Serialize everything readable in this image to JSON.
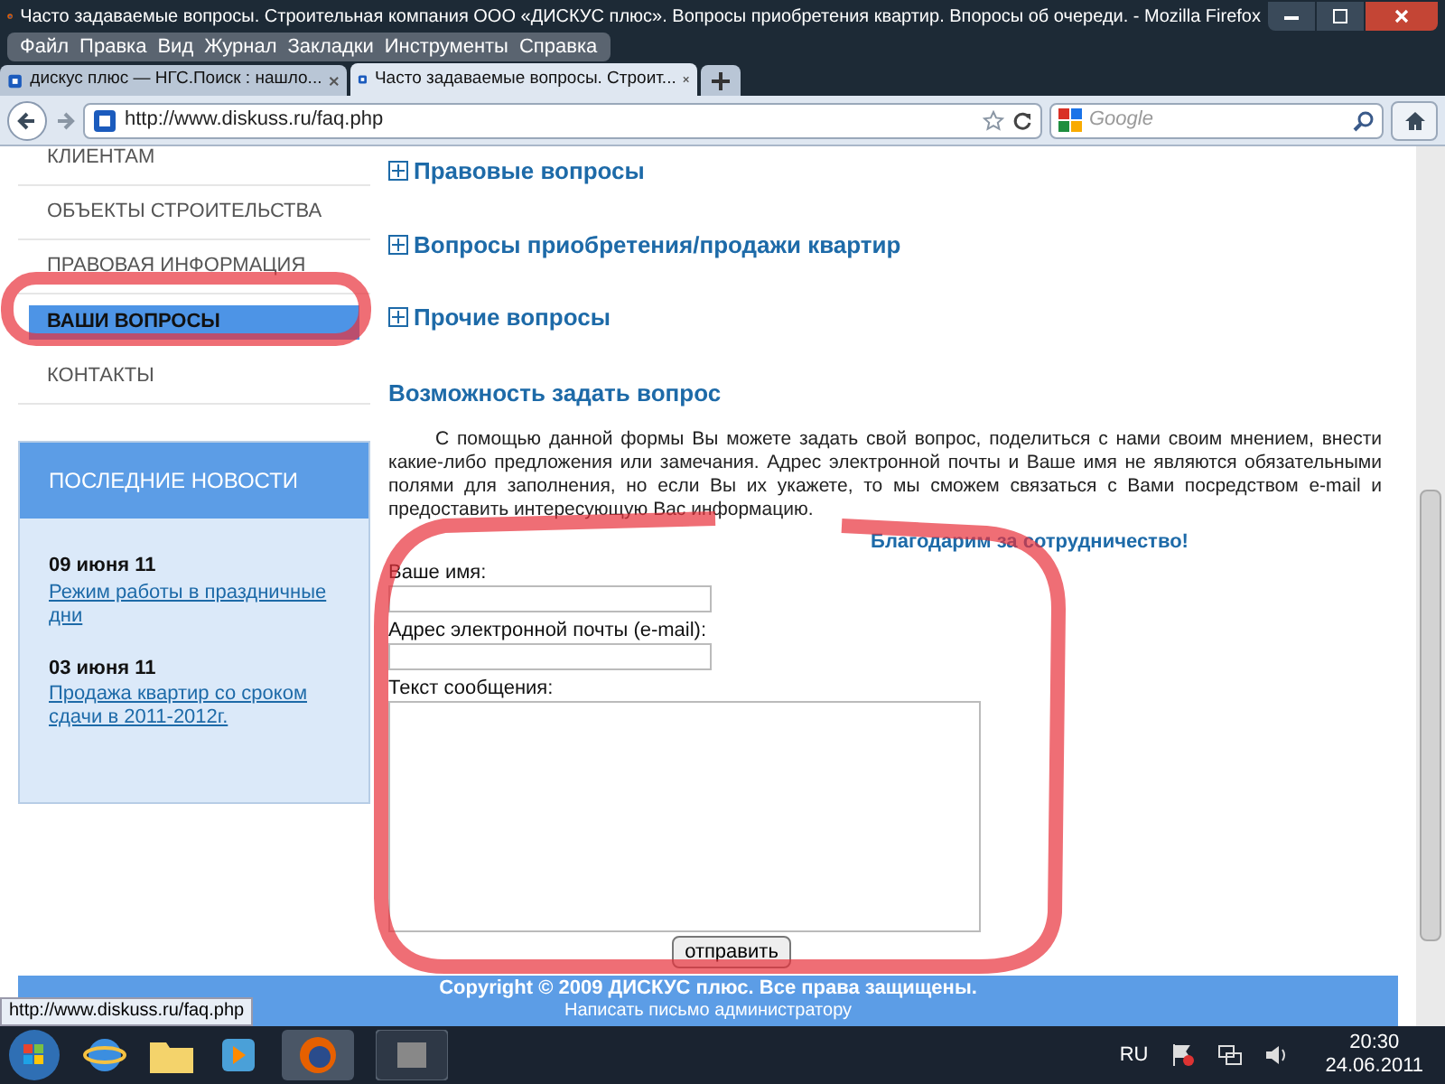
{
  "window": {
    "title": "Часто задаваемые вопросы. Строительная компания ООО «ДИСКУС плюс». Вопросы приобретения квартир. Впоросы об очереди. - Mozilla Firefox"
  },
  "menu": [
    "Файл",
    "Правка",
    "Вид",
    "Журнал",
    "Закладки",
    "Инструменты",
    "Справка"
  ],
  "tabs": [
    {
      "label": "дискус плюс — НГС.Поиск : нашло...",
      "selected": false
    },
    {
      "label": "Часто задаваемые вопросы. Строит...",
      "selected": true
    }
  ],
  "address": {
    "url": "http://www.diskuss.ru/faq.php"
  },
  "search": {
    "placeholder": "Google"
  },
  "sidebar": {
    "nav": [
      {
        "label": "КЛИЕНТАМ",
        "selected": false
      },
      {
        "label": "ОБЪЕКТЫ СТРОИТЕЛЬСТВА",
        "selected": false
      },
      {
        "label": "ПРАВОВАЯ ИНФОРМАЦИЯ",
        "selected": false
      },
      {
        "label": "ВАШИ ВОПРОСЫ",
        "selected": true
      },
      {
        "label": "КОНТАКТЫ",
        "selected": false
      }
    ],
    "news_title": "ПОСЛЕДНИЕ НОВОСТИ",
    "news": [
      {
        "date": "09 июня 11",
        "link": "Режим работы в праздничные дни"
      },
      {
        "date": "03 июня 11",
        "link": "Продажа квартир со сроком сдачи в 2011-2012г."
      }
    ]
  },
  "sections": [
    {
      "label": "Правовые вопросы",
      "expanded": false
    },
    {
      "label": "Вопросы приобретения/продажи квартир",
      "expanded": false
    },
    {
      "label": "Прочие вопросы",
      "expanded": false
    }
  ],
  "form": {
    "heading": "Возможность задать вопрос",
    "intro": "С помощью данной формы Вы можете задать свой вопрос, поделиться с нами своим мнением, внести какие-либо предложения или замечания. Адрес электронной почты и Ваше имя не являются обязательными полями для заполнения, но если Вы их укажете, то мы сможем связаться с Вами посредством e-mail и предоставить интересующую Вас информацию.",
    "thanks": "Благодарим за сотрудничество!",
    "fields": [
      {
        "label": "Ваше имя:",
        "kind": "input"
      },
      {
        "label": "Адрес электронной почты (e-mail):",
        "kind": "input"
      },
      {
        "label": "Текст сообщения:",
        "kind": "textarea"
      }
    ],
    "submit": "отправить"
  },
  "footer": {
    "copyright": "Copyright © 2009 ДИСКУС плюс. Все права защищены.",
    "link": "Написать письмо администратору"
  },
  "status_url": "http://www.diskuss.ru/faq.php",
  "taskbar": {
    "language": "RU",
    "time": "20:30",
    "date": "24.06.2011"
  }
}
